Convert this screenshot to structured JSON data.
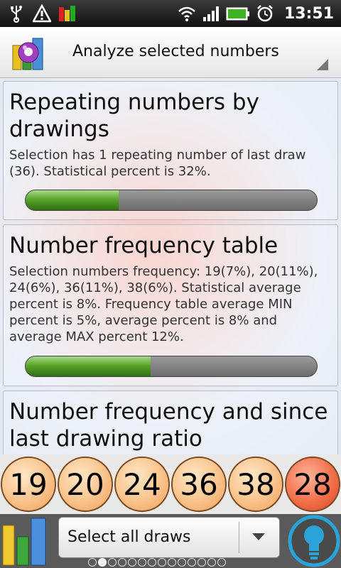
{
  "status_bar": {
    "time": "13:51",
    "icons": [
      "usb-icon",
      "warning-icon",
      "signal-bars-icon",
      "wifi-icon",
      "cell-signal-icon",
      "battery-icon",
      "alarm-icon"
    ]
  },
  "title_bar": {
    "title": "Analyze selected numbers",
    "icon": "app-logo-icon"
  },
  "cards": [
    {
      "title": "Repeating numbers by drawings",
      "text": "Selection has 1 repeating number of last draw (36). Statistical percent is 32%.",
      "progress": 0.32
    },
    {
      "title": "Number frequency table",
      "text": "Selection numbers frequency: 19(7%), 20(11%), 24(6%), 36(11%), 38(6%). Statistical average percent is 8%. Frequency table average MIN percent is 5%, average percent is 8% and average MAX percent 12%.",
      "progress": 0.43
    },
    {
      "title": "Number frequency and since last drawing ratio"
    }
  ],
  "balls": [
    {
      "number": "19",
      "color": "#f9c690"
    },
    {
      "number": "20",
      "color": "#f9c690"
    },
    {
      "number": "24",
      "color": "#f9c690"
    },
    {
      "number": "36",
      "color": "#f9c690"
    },
    {
      "number": "38",
      "color": "#f9c690"
    },
    {
      "number": "28",
      "color": "#f2704c"
    }
  ],
  "bottom_bar": {
    "select_value": "Select all draws",
    "page_count": 14,
    "active_page": 1
  },
  "colors": {
    "accent": "#29a3d8",
    "progress_fill": "#5aa52a"
  }
}
